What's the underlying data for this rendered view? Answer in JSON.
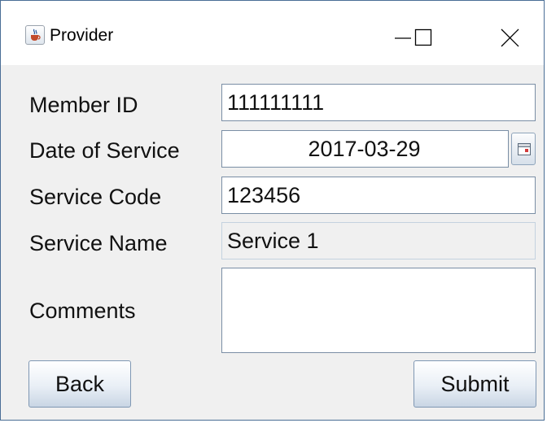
{
  "window": {
    "title": "Provider",
    "icon": "java-cup-icon",
    "controls": [
      "minimize-icon",
      "maximize-icon",
      "close-icon"
    ]
  },
  "form": {
    "member_id": {
      "label": "Member ID",
      "value": "111111111"
    },
    "date_of_service": {
      "label": "Date of Service",
      "value": "2017-03-29",
      "picker_icon": "calendar-icon"
    },
    "service_code": {
      "label": "Service Code",
      "value": "123456"
    },
    "service_name": {
      "label": "Service Name",
      "value": "Service 1"
    },
    "comments": {
      "label": "Comments",
      "value": ""
    }
  },
  "buttons": {
    "back": "Back",
    "submit": "Submit"
  },
  "colors": {
    "window_border": "#4a6e96",
    "body_background": "#f0f0f0",
    "field_border": "#7a8ea5"
  }
}
